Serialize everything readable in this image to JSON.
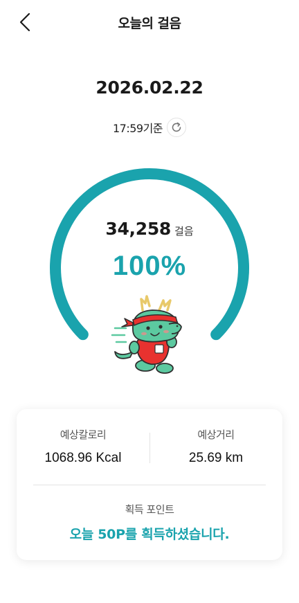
{
  "header": {
    "title": "오늘의 걸음",
    "back_icon": "chevron-left-icon"
  },
  "date": "2026.02.22",
  "updated": {
    "time_text": "17:59기준",
    "refresh_icon": "refresh-icon"
  },
  "progress": {
    "steps": "34,258",
    "steps_unit": "걸음",
    "percent_text": "100%",
    "fraction": 1.0,
    "color": "#1aa3ad"
  },
  "mascot": {
    "name": "dragon-mascot-running"
  },
  "summary": {
    "calories_label": "예상칼로리",
    "calories_value": "1068.96 Kcal",
    "distance_label": "예상거리",
    "distance_value": "25.69 km",
    "points_label": "획득 포인트",
    "points_message": "오늘 50P를 획득하셨습니다."
  },
  "colors": {
    "accent": "#1aa3ad",
    "mascot_green": "#5cc9a0",
    "mascot_red": "#e8322f"
  }
}
